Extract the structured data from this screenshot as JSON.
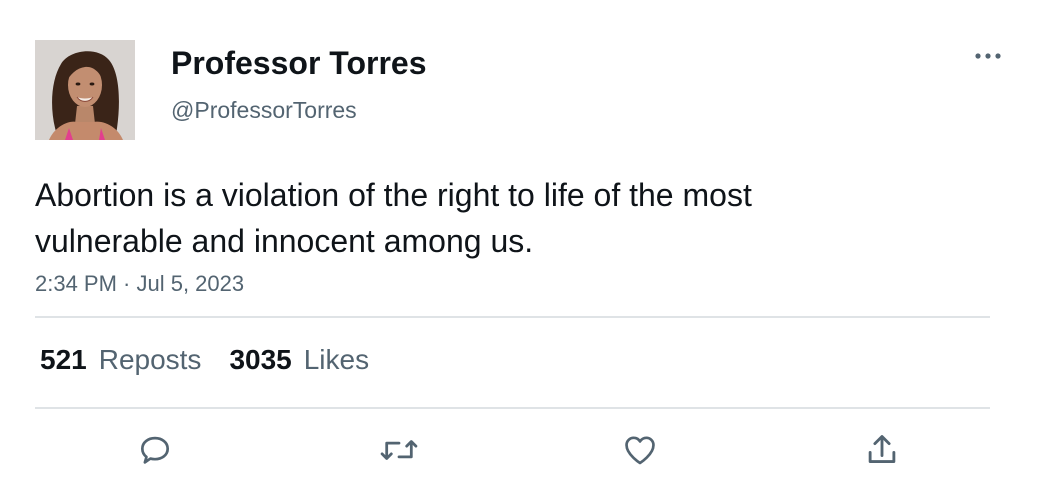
{
  "author": {
    "display_name": "Professor Torres",
    "handle": "@ProfessorTorres"
  },
  "tweet": {
    "text": "Abortion is a violation of the right to life of the most vulnerable and innocent among us.",
    "timestamp": "2:34 PM · Jul 5, 2023"
  },
  "stats": {
    "reposts_count": "521",
    "reposts_label": "Reposts",
    "likes_count": "3035",
    "likes_label": "Likes"
  },
  "icons": {
    "more": "more-horizontal-icon",
    "reply": "reply-icon",
    "repost": "repost-icon",
    "like": "heart-icon",
    "share": "share-icon"
  },
  "colors": {
    "text_primary": "#0f1419",
    "text_secondary": "#536471",
    "divider": "#dfe3e6",
    "icon": "#536471"
  }
}
